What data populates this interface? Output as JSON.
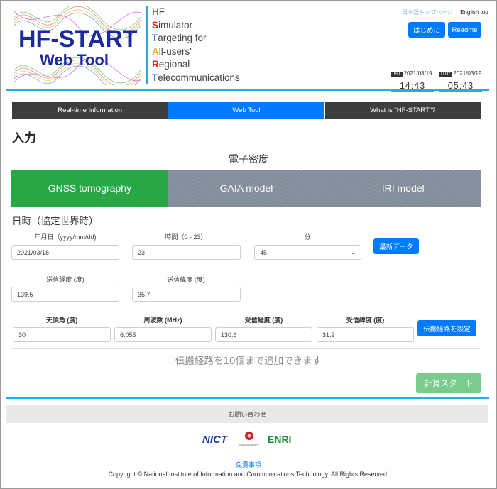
{
  "header": {
    "logo_line1": "HF-START",
    "logo_line2": "Web Tool",
    "acronym": [
      {
        "letter": "H",
        "rest": "F",
        "color": "#2aa84a"
      },
      {
        "letter": "S",
        "rest": "imulator",
        "color": "#e0252a"
      },
      {
        "letter": "T",
        "rest": "argeting for",
        "color": "#2a6cd8"
      },
      {
        "letter": "A",
        "rest": "ll-users'",
        "color": "#e8b41c"
      },
      {
        "letter": "R",
        "rest": "egional",
        "color": "#e0252a"
      },
      {
        "letter": "T",
        "rest": "elecommunications",
        "color": "#2a6cd8"
      }
    ],
    "link_jp": "日本語トップページ",
    "link_en": "English top",
    "btn_start": "はじめに",
    "btn_readme": "Readme",
    "jst": {
      "label": "JST",
      "date": "2021/03/19",
      "time": "14:43"
    },
    "utc": {
      "label": "UTC",
      "date": "2021/03/19",
      "time": "05:43"
    }
  },
  "nav": [
    "Real-time Information",
    "Web Tool",
    "What is \"HF-START\"?"
  ],
  "page_title": "入力",
  "section_title": "電子密度",
  "model_tabs": [
    "GNSS tomography",
    "GAIA model",
    "IRI model"
  ],
  "datetime": {
    "title": "日時（協定世界時）",
    "date_label": "年月日（yyyy/mm/dd)",
    "date_value": "2021/03/18",
    "hour_label": "時間（0 - 23）",
    "hour_value": "23",
    "minute_label": "分",
    "minute_value": "45",
    "latest_button": "最新データ"
  },
  "transmitter": {
    "lon_label": "送信経度 (度)",
    "lon_value": "139.5",
    "lat_label": "送信緯度 (度)",
    "lat_value": "35.7"
  },
  "path": {
    "zenith_label": "天頂角 (度)",
    "zenith_value": "30",
    "freq_label": "周波数 (MHz)",
    "freq_value": "6.055",
    "rx_lon_label": "受信経度 (度)",
    "rx_lon_value": "130.6",
    "rx_lat_label": "受信緯度 (度)",
    "rx_lat_value": "31.2",
    "set_button": "伝搬経路を設定"
  },
  "note": "伝搬経路を10個まで追加できます",
  "start_button": "計算スタート",
  "footer": {
    "contact": "お問い合わせ",
    "logo_nict": "NICT",
    "logo_chiba": "CHIBA UNIVERSITY",
    "logo_enri": "ENRI",
    "disclaimer": "免責事項",
    "copyright": "Copyright © National Institute of Information and Communications Technology. All Rights Reserved."
  }
}
